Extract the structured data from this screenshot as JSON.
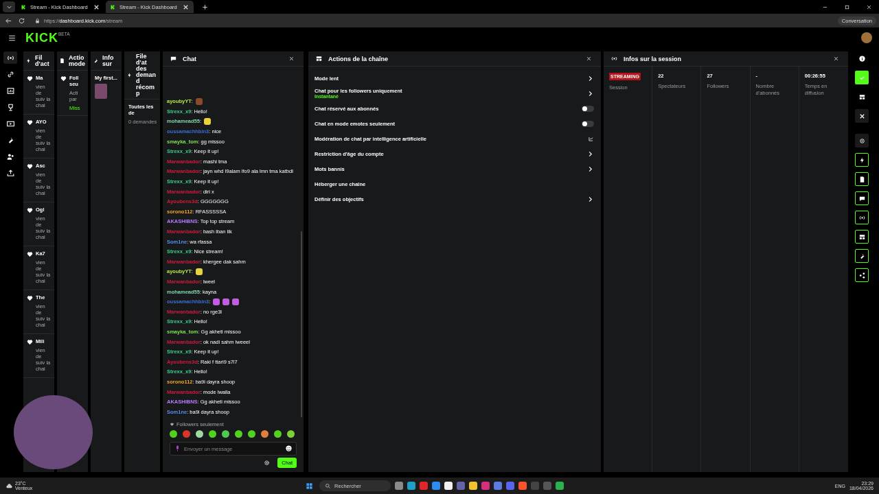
{
  "browser": {
    "tabs": [
      {
        "title": "Stream - Kick Dashboard",
        "selected": false
      },
      {
        "title": "Stream - Kick Dashboard",
        "selected": true
      }
    ],
    "url_prefix": "https://",
    "url_host": "dashboard.kick.com",
    "url_path": "/stream",
    "profile_button": "Conversation"
  },
  "app_header": {
    "logo": "KICK",
    "logo_tag": "BETA"
  },
  "rail": [
    {
      "kind": "live",
      "selected": true
    },
    {
      "kind": "link",
      "selected": false
    },
    {
      "kind": "chart",
      "selected": false
    },
    {
      "kind": "trophy",
      "selected": false
    },
    {
      "kind": "video",
      "selected": false
    },
    {
      "kind": "wrench",
      "selected": false
    },
    {
      "kind": "users",
      "selected": false
    },
    {
      "kind": "upload",
      "selected": false
    }
  ],
  "activity_panel": {
    "title": "Fil d'act",
    "items": [
      {
        "name": "Ma",
        "text": "vien de suiv la chai"
      },
      {
        "name": "AYO",
        "text": "vien de suiv la chai"
      },
      {
        "name": "Asc",
        "text": "vien de suiv la chai"
      },
      {
        "name": "Ogl",
        "text": "vien de suiv la chai"
      },
      {
        "name": "Ka7",
        "text": "vien de suiv la chai"
      },
      {
        "name": "The",
        "text": "vien de suiv la chai"
      },
      {
        "name": "Mili",
        "text": "vien de suiv la chai"
      }
    ]
  },
  "mod_panel": {
    "title": "Actio mode",
    "item": {
      "name": "Foll seu",
      "text": "Acti par",
      "user": "Miss"
    }
  },
  "info_panel": {
    "title": "Info sur",
    "stream_title": "My first..."
  },
  "rewards_panel": {
    "title": "File d'at des demand récomp",
    "filter": "Toutes les de",
    "count": "0 demandes"
  },
  "chat": {
    "title": "Chat",
    "messages": [
      {
        "user": "ayoubyYT",
        "color": "#b6e64a",
        "text": ":",
        "emotes": [
          {
            "color": "#8a4a2a"
          }
        ]
      },
      {
        "user": "Strexx_x9",
        "color": "#3ccf8b",
        "text": ": Hello!"
      },
      {
        "user": "mohamead55",
        "color": "#7fd9a9",
        "text": ":",
        "emotes": [
          {
            "color": "#e8d23a"
          }
        ]
      },
      {
        "user": "oussamachhbin3",
        "color": "#3b6fd6",
        "text": ": nice"
      },
      {
        "user": "smayka_tom",
        "color": "#7ee04f",
        "text": ": gg missoo"
      },
      {
        "user": "Strexx_x9",
        "color": "#3ccf8b",
        "text": ": Keep it up!"
      },
      {
        "user": "Marwanbador",
        "color": "#d11a3c",
        "text": ": mashi tma"
      },
      {
        "user": "Marwanbador",
        "color": "#d11a3c",
        "text": ": jayn whd l9alam lfo9 ala lmn tma katbdl"
      },
      {
        "user": "Strexx_x9",
        "color": "#3ccf8b",
        "text": ": Keep it up!"
      },
      {
        "user": "Marwanbador",
        "color": "#d11a3c",
        "text": ": diri x"
      },
      {
        "user": "Ayoubens3d",
        "color": "#d11a3c",
        "text": ": GGGGGGG"
      },
      {
        "user": "sorono112",
        "color": "#f5a623",
        "text": ": RFASSSSSA"
      },
      {
        "user": "AKASHIBNS",
        "color": "#b57bff",
        "text": ": Top top stream"
      },
      {
        "user": "Marwanbador",
        "color": "#d11a3c",
        "text": ": bash iban lik"
      },
      {
        "user": "Som1ne",
        "color": "#5b8def",
        "text": ": wa rfassa"
      },
      {
        "user": "Strexx_x9",
        "color": "#3ccf8b",
        "text": ": Nice stream!"
      },
      {
        "user": "Marwanbador",
        "color": "#d11a3c",
        "text": ": khergee dak sahm"
      },
      {
        "user": "ayoubyYT",
        "color": "#b6e64a",
        "text": ":",
        "emotes": [
          {
            "color": "#e8d23a"
          }
        ]
      },
      {
        "user": "Marwanbador",
        "color": "#d11a3c",
        "text": ": lweel"
      },
      {
        "user": "mohamead55",
        "color": "#7fd9a9",
        "text": ": kayna"
      },
      {
        "user": "oussamachhbin3",
        "color": "#3b6fd6",
        "text": ":",
        "emotes": [
          {
            "color": "#c35ce0"
          },
          {
            "color": "#c35ce0"
          },
          {
            "color": "#c35ce0"
          }
        ]
      },
      {
        "user": "Marwanbador",
        "color": "#d11a3c",
        "text": ": no rge3l"
      },
      {
        "user": "Strexx_x9",
        "color": "#3ccf8b",
        "text": ": Hello!"
      },
      {
        "user": "smayka_tom",
        "color": "#7ee04f",
        "text": ": Gg akheti missoo"
      },
      {
        "user": "Marwanbador",
        "color": "#d11a3c",
        "text": ": ok nadi sahm lweeel"
      },
      {
        "user": "Strexx_x9",
        "color": "#3ccf8b",
        "text": ": Keep it up!"
      },
      {
        "user": "Ayoubens3d",
        "color": "#d11a3c",
        "text": ": Raki f ttari9 s7i7"
      },
      {
        "user": "Strexx_x9",
        "color": "#3ccf8b",
        "text": ": Hello!"
      },
      {
        "user": "sorono112",
        "color": "#f5a623",
        "text": ": ba9i dayra shoop"
      },
      {
        "user": "Marwanbador",
        "color": "#d11a3c",
        "text": ": mode lwalla"
      },
      {
        "user": "AKASHIBNS",
        "color": "#b57bff",
        "text": ": Gg akheti missoo"
      },
      {
        "user": "Som1ne",
        "color": "#5b8def",
        "text": ": ba9i dayra shoop"
      }
    ],
    "mode_notice": "Followers seulement",
    "emote_bar": [
      {
        "color": "#53d11f"
      },
      {
        "color": "#d9352b"
      },
      {
        "color": "#9fd8a0"
      },
      {
        "color": "#53d11f"
      },
      {
        "color": "#4fc94f"
      },
      {
        "color": "#53d11f"
      },
      {
        "color": "#53d11f"
      },
      {
        "color": "#e0803a"
      },
      {
        "color": "#53d11f"
      },
      {
        "color": "#7dcf3a"
      }
    ],
    "input": {
      "placeholder": "Envoyer un message"
    },
    "send_button": "Chat"
  },
  "actions": {
    "title": "Actions de la chaîne",
    "items": [
      {
        "label": "Mode lent",
        "kind": "arrow"
      },
      {
        "label": "Chat pour les followers uniquement",
        "sublabel": "Instantané",
        "kind": "arrow"
      },
      {
        "label": "Chat réservé aux abonnés",
        "kind": "toggle",
        "on": false
      },
      {
        "label": "Chat en mode emotes seulement",
        "kind": "toggle",
        "on": false
      },
      {
        "label": "Modération de chat par intelligence artificielle",
        "kind": "external"
      },
      {
        "label": "Restriction d'âge du compte",
        "kind": "arrow"
      },
      {
        "label": "Mots bannis",
        "kind": "arrow"
      },
      {
        "label": "Héberger une chaîne",
        "kind": "plain"
      },
      {
        "label": "Définir des objectifs",
        "kind": "arrow"
      }
    ]
  },
  "session": {
    "title": "Infos sur la session",
    "badge": "STREAMING",
    "stats": [
      {
        "label": "Session",
        "kind": "badge"
      },
      {
        "value": "22",
        "label": "Spectateurs",
        "kind": "stat"
      },
      {
        "value": "27",
        "label": "Followers",
        "kind": "stat"
      },
      {
        "value": "-",
        "label": "Nombre d'abonnés",
        "kind": "stat"
      },
      {
        "value": "00:26:55",
        "label": "Temps en diffusion",
        "kind": "stat"
      }
    ]
  },
  "toolbar": [
    {
      "kind": "info",
      "outlined": false
    },
    {
      "kind": "check",
      "outlined": false
    },
    {
      "kind": "layout",
      "outlined": false
    },
    {
      "kind": "close",
      "outlined": false
    },
    {
      "kind": "target",
      "outlined": false
    },
    {
      "kind": "bolt",
      "outlined": true
    },
    {
      "kind": "note",
      "outlined": true
    },
    {
      "kind": "chat",
      "outlined": true
    },
    {
      "kind": "live",
      "outlined": true
    },
    {
      "kind": "layout",
      "outlined": true
    },
    {
      "kind": "wrench",
      "outlined": true
    },
    {
      "kind": "share",
      "outlined": true
    }
  ],
  "taskbar": {
    "weather_temp": "23°C",
    "weather_text": "Venteux",
    "search": "Rechercher",
    "apps": [
      {
        "color": "#8a8a8a"
      },
      {
        "color": "#1fa0c9"
      },
      {
        "color": "#e0262b"
      },
      {
        "color": "#2d8cf0"
      },
      {
        "color": "#f0f0f0"
      },
      {
        "color": "#6264a7"
      },
      {
        "color": "#f2c12e"
      },
      {
        "color": "#d6307c"
      },
      {
        "color": "#5c7be0"
      },
      {
        "color": "#5865f2"
      },
      {
        "color": "#fb542b"
      },
      {
        "color": "#444444"
      },
      {
        "color": "#555555"
      },
      {
        "color": "#2bb24c"
      }
    ],
    "lang": "ENG",
    "time": "23:29",
    "date": "18/04/2026"
  }
}
